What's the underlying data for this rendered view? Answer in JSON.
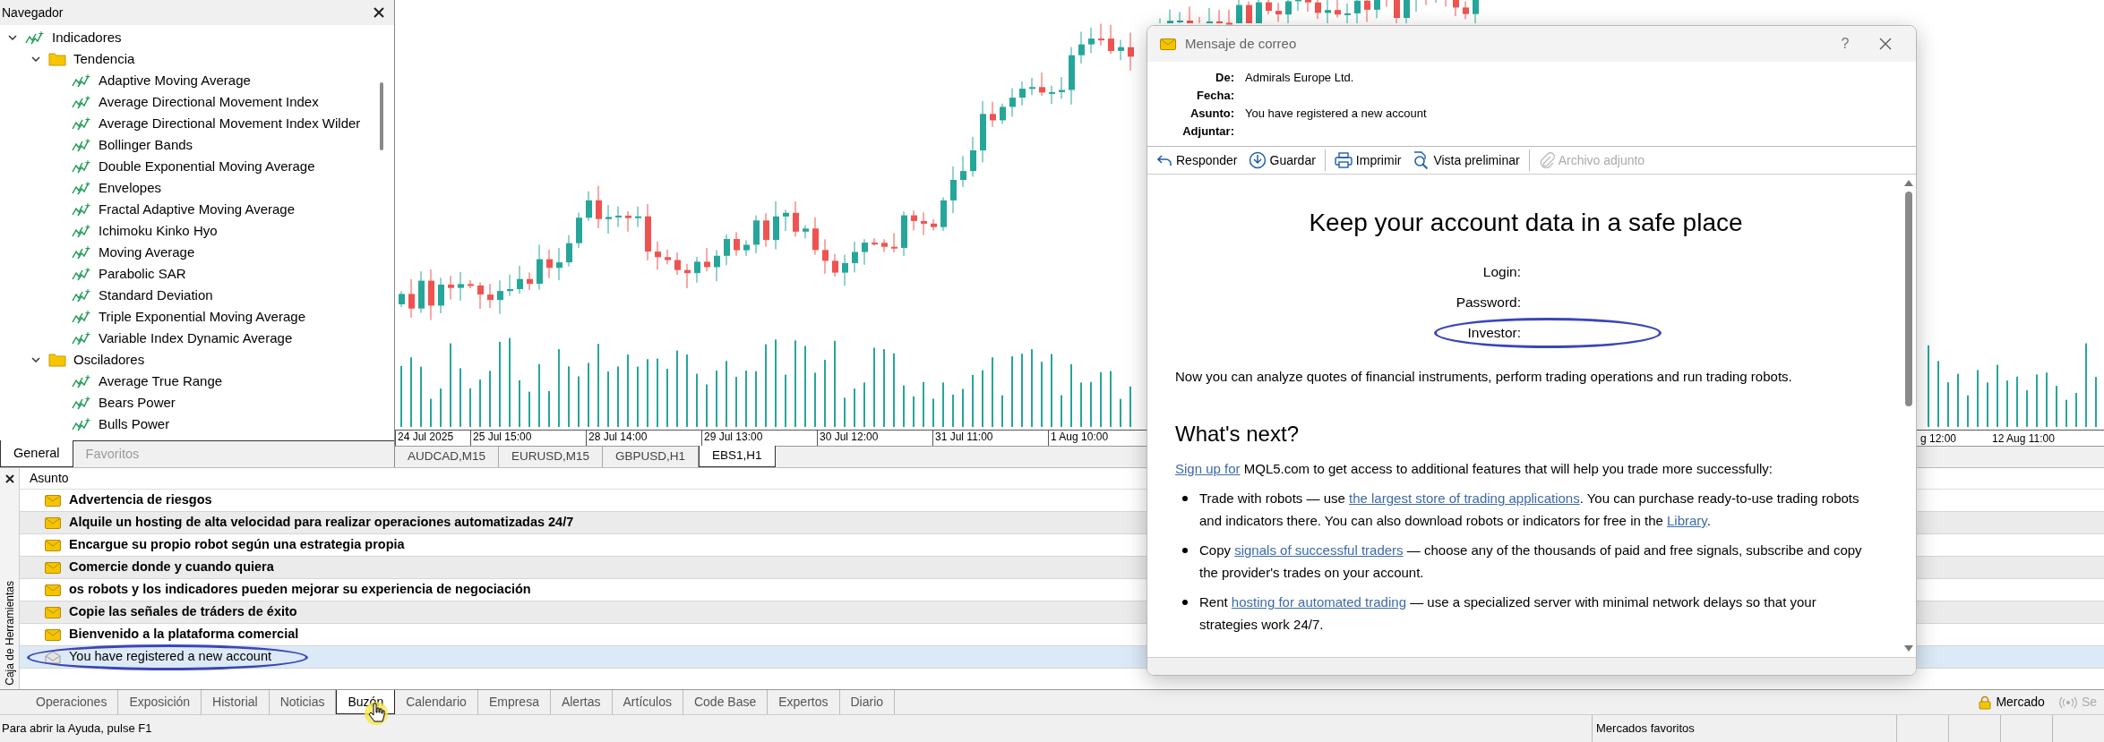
{
  "navigator": {
    "title": "Navegador",
    "tree": [
      {
        "label": "Indicadores",
        "kind": "indicator",
        "expanded": true,
        "children": [
          {
            "label": "Tendencia",
            "kind": "folder",
            "expanded": true,
            "children": [
              {
                "label": "Adaptive Moving Average",
                "kind": "indicator"
              },
              {
                "label": "Average Directional Movement Index",
                "kind": "indicator"
              },
              {
                "label": "Average Directional Movement Index Wilder",
                "kind": "indicator"
              },
              {
                "label": "Bollinger Bands",
                "kind": "indicator"
              },
              {
                "label": "Double Exponential Moving Average",
                "kind": "indicator"
              },
              {
                "label": "Envelopes",
                "kind": "indicator"
              },
              {
                "label": "Fractal Adaptive Moving Average",
                "kind": "indicator"
              },
              {
                "label": "Ichimoku Kinko Hyo",
                "kind": "indicator"
              },
              {
                "label": "Moving Average",
                "kind": "indicator"
              },
              {
                "label": "Parabolic SAR",
                "kind": "indicator"
              },
              {
                "label": "Standard Deviation",
                "kind": "indicator"
              },
              {
                "label": "Triple Exponential Moving Average",
                "kind": "indicator"
              },
              {
                "label": "Variable Index Dynamic Average",
                "kind": "indicator"
              }
            ]
          },
          {
            "label": "Osciladores",
            "kind": "folder",
            "expanded": true,
            "children": [
              {
                "label": "Average True Range",
                "kind": "indicator"
              },
              {
                "label": "Bears Power",
                "kind": "indicator"
              },
              {
                "label": "Bulls Power",
                "kind": "indicator"
              }
            ]
          }
        ]
      }
    ],
    "tabs": [
      {
        "label": "General",
        "selected": true
      },
      {
        "label": "Favoritos",
        "selected": false
      }
    ]
  },
  "chart": {
    "x_axis_labels": [
      "24 Jul 2025",
      "25 Jul 15:00",
      "28 Jul 14:00",
      "29 Jul 13:00",
      "30 Jul 12:00",
      "31 Jul 11:00",
      "1 Aug 10:00"
    ],
    "x_axis_labels_right": [
      "g 12:00",
      "12 Aug 11:00"
    ],
    "tabs": [
      {
        "label": "AUDCAD,M15",
        "selected": false
      },
      {
        "label": "EURUSD,M15",
        "selected": false
      },
      {
        "label": "GBPUSD,H1",
        "selected": false
      },
      {
        "label": "EBS1,H1",
        "selected": true
      }
    ]
  },
  "toolbox": {
    "title": "Caja de Herramientas",
    "column": "Asunto",
    "messages": [
      {
        "subject": "Advertencia de riesgos",
        "unread": true,
        "selected": false,
        "circled": false
      },
      {
        "subject": "Alquile un hosting de alta velocidad para realizar operaciones automatizadas 24/7",
        "unread": true,
        "selected": false,
        "circled": false
      },
      {
        "subject": "Encargue su propio robot según una estrategia propia",
        "unread": true,
        "selected": false,
        "circled": false
      },
      {
        "subject": "Comercie donde y cuando quiera",
        "unread": true,
        "selected": false,
        "circled": false
      },
      {
        "subject": "os robots y los indicadores pueden mejorar su experiencia de negociación",
        "unread": true,
        "selected": false,
        "circled": false
      },
      {
        "subject": "Copie las señales de tráders de éxito",
        "unread": true,
        "selected": false,
        "circled": false
      },
      {
        "subject": "Bienvenido a la plataforma comercial",
        "unread": true,
        "selected": false,
        "circled": false
      },
      {
        "subject": "You have registered a new account",
        "unread": false,
        "selected": true,
        "circled": true
      }
    ],
    "tabs": [
      {
        "label": "Operaciones",
        "selected": false,
        "hovered": false
      },
      {
        "label": "Exposición",
        "selected": false,
        "hovered": false
      },
      {
        "label": "Historial",
        "selected": false,
        "hovered": false
      },
      {
        "label": "Noticias",
        "selected": false,
        "hovered": false
      },
      {
        "label": "Buzón",
        "selected": true,
        "hovered": true
      },
      {
        "label": "Calendario",
        "selected": false,
        "hovered": false
      },
      {
        "label": "Empresa",
        "selected": false,
        "hovered": false
      },
      {
        "label": "Alertas",
        "selected": false,
        "hovered": false
      },
      {
        "label": "Artículos",
        "selected": false,
        "hovered": false
      },
      {
        "label": "Code Base",
        "selected": false,
        "hovered": false
      },
      {
        "label": "Expertos",
        "selected": false,
        "hovered": false
      },
      {
        "label": "Diario",
        "selected": false,
        "hovered": false
      }
    ],
    "right_buttons": [
      {
        "label": "Mercado",
        "kind": "lock",
        "disabled": false
      },
      {
        "label": "Se",
        "kind": "signal",
        "disabled": true
      }
    ]
  },
  "status_bar": {
    "help": "Para abrir la Ayuda, pulse F1",
    "cell": "Mercados favoritos"
  },
  "mail_window": {
    "title": "Mensaje de correo",
    "help": "?",
    "fields": [
      {
        "label": "De:",
        "value": "Admirals Europe Ltd."
      },
      {
        "label": "Fecha:"
      },
      {
        "label": "Asunto:",
        "value": "You have registered a new account"
      },
      {
        "label": "Adjuntar:"
      }
    ],
    "toolbar": [
      {
        "label": "Responder",
        "kind": "reply",
        "disabled": false,
        "separator_before": false
      },
      {
        "label": "Guardar",
        "kind": "save",
        "disabled": false,
        "separator_before": false
      },
      {
        "label": "Imprimir",
        "kind": "print",
        "disabled": false,
        "separator_before": true
      },
      {
        "label": "Vista preliminar",
        "kind": "preview",
        "disabled": false,
        "separator_before": false
      },
      {
        "label": "Archivo adjunto",
        "kind": "attach",
        "disabled": true,
        "separator_before": true
      }
    ],
    "heading": "Keep your account data in a safe place",
    "credentials": [
      {
        "label": "Login:",
        "circled": false
      },
      {
        "label": "Password:",
        "circled": false
      },
      {
        "label": "Investor:",
        "circled": true
      }
    ],
    "intro": [
      {
        "text": "Now you can analyze quotes of financial instruments, perform trading operations and run trading robots.",
        "link": false
      }
    ],
    "subheading": "What's next?",
    "lead": [
      {
        "text": "Sign up for",
        "link": true
      },
      {
        "text": " MQL5.com to get access to additional features that will help you trade more successfully:",
        "link": false
      }
    ],
    "bullets": [
      [
        {
          "text": "Trade with robots — use ",
          "link": false
        },
        {
          "text": "the largest store of trading applications",
          "link": true
        },
        {
          "text": ". You can purchase ready-to-use trading robots and indicators there. You can also download robots or indicators for free in the ",
          "link": false
        },
        {
          "text": "Library",
          "link": true
        },
        {
          "text": ".",
          "link": false
        }
      ],
      [
        {
          "text": "Copy ",
          "link": false
        },
        {
          "text": "signals of successful traders",
          "link": true
        },
        {
          "text": " — choose any of the thousands of paid and free signals, subscribe and copy the provider's trades on your account.",
          "link": false
        }
      ],
      [
        {
          "text": "Rent ",
          "link": false
        },
        {
          "text": "hosting for automated trading",
          "link": true
        },
        {
          "text": " — use a specialized server with minimal network delays so that your strategies work 24/7.",
          "link": false
        }
      ]
    ]
  }
}
